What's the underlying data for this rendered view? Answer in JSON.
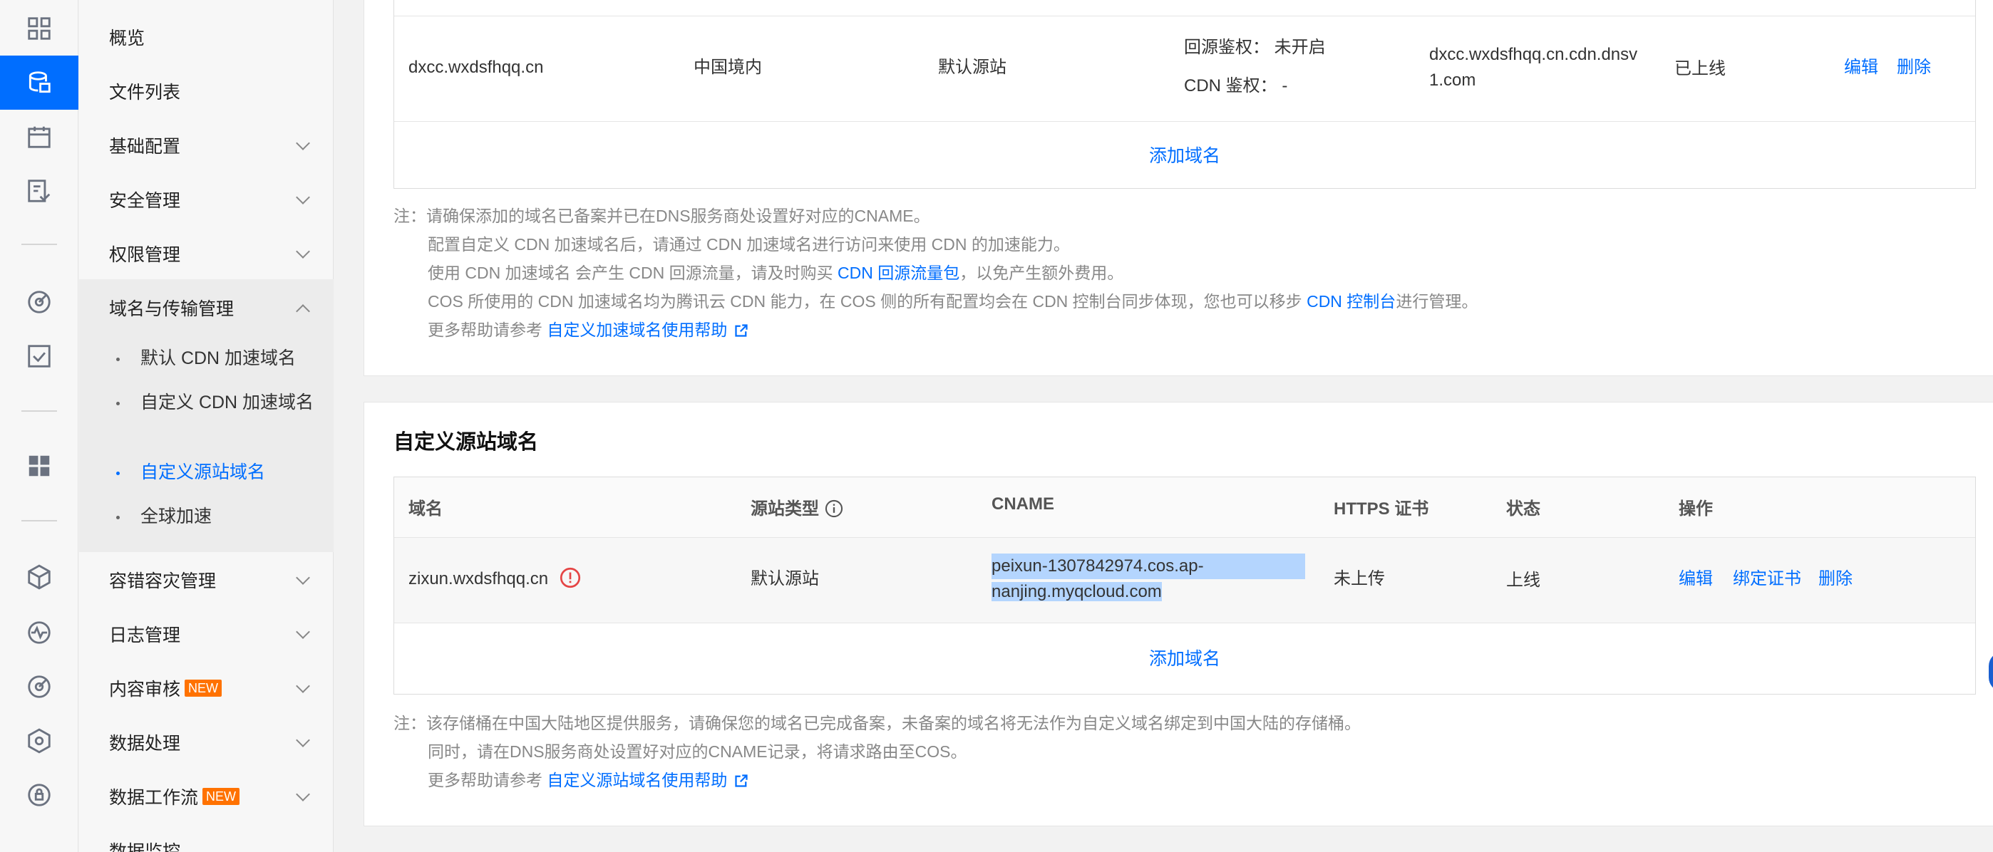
{
  "rail": {
    "icons": [
      "grid-icon",
      "bucket-icon",
      "calendar-icon",
      "checklist-icon",
      "radar-icon",
      "check-square-icon",
      "apps-icon",
      "cube-icon",
      "pulse-icon",
      "radar2-icon",
      "hexagon-icon",
      "lock-circle-icon"
    ]
  },
  "menu": {
    "overview": "概览",
    "file_list": "文件列表",
    "basic_config": "基础配置",
    "security": "安全管理",
    "permissions": "权限管理",
    "domain_transfer": "域名与传输管理",
    "sub_default_cdn": "默认 CDN 加速域名",
    "sub_custom_cdn": "自定义 CDN 加速域名",
    "sub_custom_origin": "自定义源站域名",
    "sub_global": "全球加速",
    "disaster": "容错容灾管理",
    "logs": "日志管理",
    "content_audit": "内容审核",
    "data_process": "数据处理",
    "workflow": "数据工作流",
    "monitor": "数据监控",
    "new_badge": "NEW"
  },
  "cdn_table": {
    "row": {
      "domain": "dxcc.wxdsfhqq.cn",
      "region": "中国境内",
      "origin": "默认源站",
      "auth_label": "回源鉴权：",
      "auth_value": "未开启",
      "cdn_auth_label": "CDN 鉴权：",
      "cdn_auth_value": "-",
      "cname_line1": "dxcc.wxdsfhqq.cn.cdn.dnsv",
      "cname_line2": "1.com",
      "status": "已上线",
      "edit": "编辑",
      "delete": "删除"
    },
    "add": "添加域名"
  },
  "cdn_notes": {
    "l1": "注：请确保添加的域名已备案并已在DNS服务商处设置好对应的CNAME。",
    "l2": "配置自定义 CDN 加速域名后，请通过 CDN 加速域名进行访问来使用 CDN 的加速能力。",
    "l3a": "使用 CDN 加速域名 会产生 CDN 回源流量，请及时购买 ",
    "l3link": "CDN 回源流量包",
    "l3b": "，以免产生额外费用。",
    "l4a": "COS 所使用的 CDN 加速域名均为腾讯云 CDN 能力，在 COS 侧的所有配置均会在 CDN 控制台同步体现，您也可以移步 ",
    "l4link": "CDN 控制台",
    "l4b": "进行管理。",
    "l5a": "更多帮助请参考 ",
    "l5link": "自定义加速域名使用帮助"
  },
  "origin_card": {
    "title": "自定义源站域名",
    "headers": {
      "domain": "域名",
      "origin_type": "源站类型",
      "cname": "CNAME",
      "https": "HTTPS 证书",
      "status": "状态",
      "actions": "操作"
    },
    "row": {
      "domain": "zixun.wxdsfhqq.cn",
      "origin": "默认源站",
      "cname_line1": "peixun-1307842974.cos.ap-",
      "cname_line2": "nanjing.myqcloud.com",
      "https": "未上传",
      "status": "上线",
      "edit": "编辑",
      "bind": "绑定证书",
      "delete": "删除"
    },
    "add": "添加域名"
  },
  "origin_notes": {
    "l1": "注：该存储桶在中国大陆地区提供服务，请确保您的域名已完成备案，未备案的域名将无法作为自定义域名绑定到中国大陆的存储桶。",
    "l2": "同时，请在DNS服务商处设置好对应的CNAME记录，将请求路由至COS。",
    "l3a": "更多帮助请参考 ",
    "l3link": "自定义源站域名使用帮助"
  }
}
